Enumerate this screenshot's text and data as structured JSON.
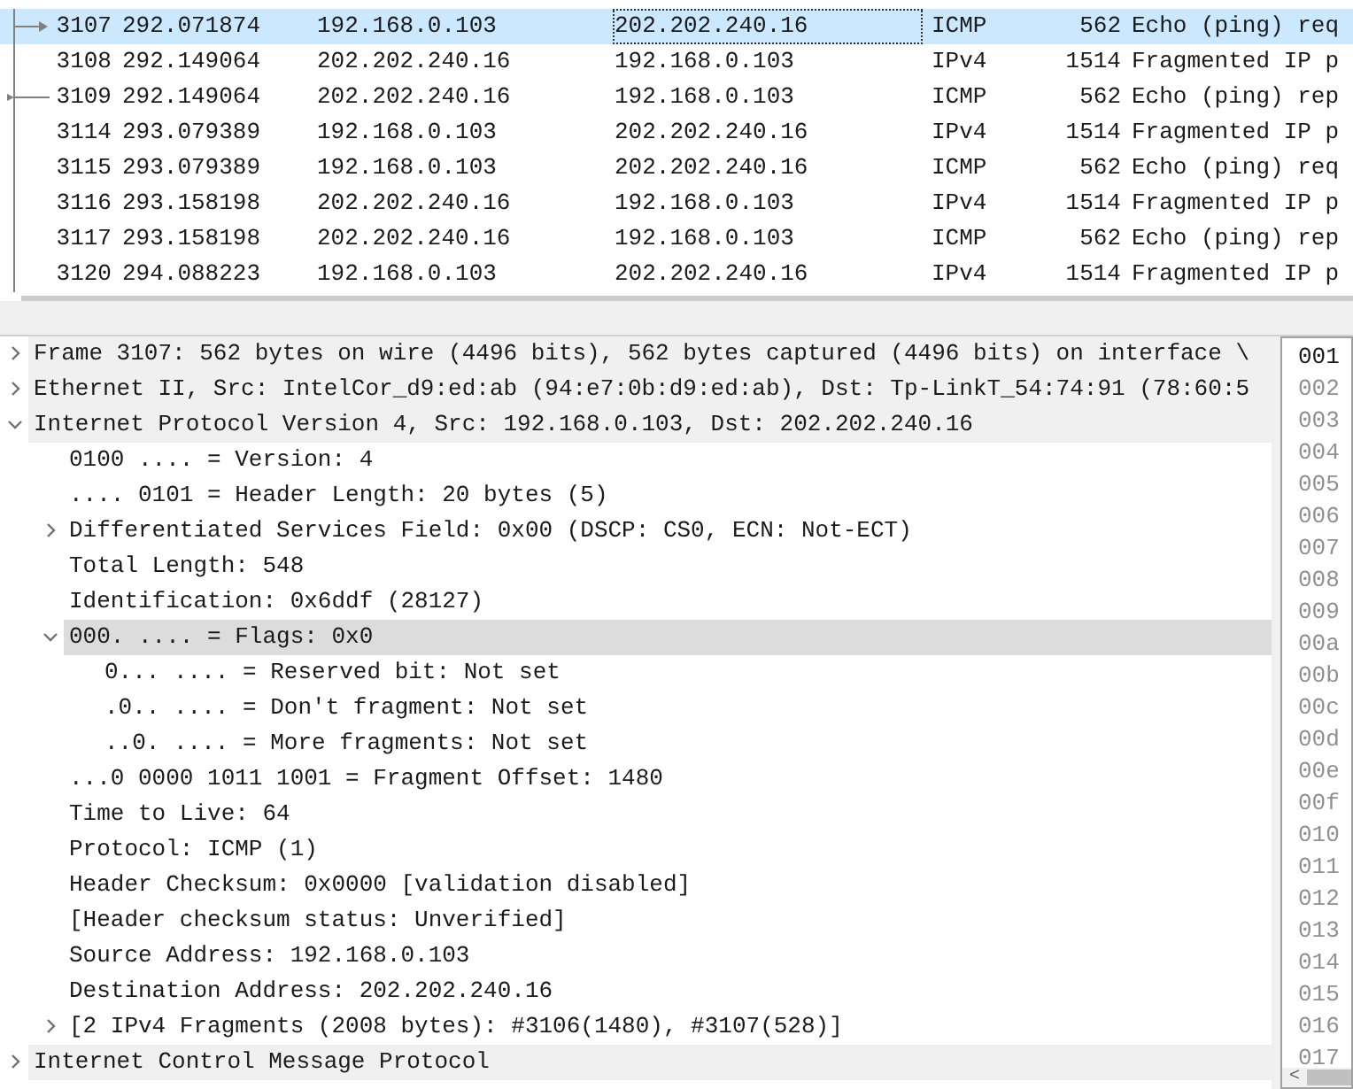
{
  "packets": [
    {
      "kind": "request",
      "no": "3107",
      "time": "292.071874",
      "source": "192.168.0.103",
      "destination": "202.202.240.16",
      "protocol": "ICMP",
      "length": "562",
      "info": "Echo (ping) req",
      "selected": true
    },
    {
      "kind": "line",
      "no": "3108",
      "time": "292.149064",
      "source": "202.202.240.16",
      "destination": "192.168.0.103",
      "protocol": "IPv4",
      "length": "1514",
      "info": "Fragmented IP p",
      "selected": false
    },
    {
      "kind": "reply",
      "no": "3109",
      "time": "292.149064",
      "source": "202.202.240.16",
      "destination": "192.168.0.103",
      "protocol": "ICMP",
      "length": "562",
      "info": "Echo (ping) rep",
      "selected": false
    },
    {
      "kind": "line",
      "no": "3114",
      "time": "293.079389",
      "source": "192.168.0.103",
      "destination": "202.202.240.16",
      "protocol": "IPv4",
      "length": "1514",
      "info": "Fragmented IP p",
      "selected": false
    },
    {
      "kind": "line",
      "no": "3115",
      "time": "293.079389",
      "source": "192.168.0.103",
      "destination": "202.202.240.16",
      "protocol": "ICMP",
      "length": "562",
      "info": "Echo (ping) req",
      "selected": false
    },
    {
      "kind": "line",
      "no": "3116",
      "time": "293.158198",
      "source": "202.202.240.16",
      "destination": "192.168.0.103",
      "protocol": "IPv4",
      "length": "1514",
      "info": "Fragmented IP p",
      "selected": false
    },
    {
      "kind": "line",
      "no": "3117",
      "time": "293.158198",
      "source": "202.202.240.16",
      "destination": "192.168.0.103",
      "protocol": "ICMP",
      "length": "562",
      "info": "Echo (ping) rep",
      "selected": false
    },
    {
      "kind": "line",
      "no": "3120",
      "time": "294.088223",
      "source": "192.168.0.103",
      "destination": "202.202.240.16",
      "protocol": "IPv4",
      "length": "1514",
      "info": "Fragmented IP p",
      "selected": false
    }
  ],
  "details": [
    {
      "text": "Frame 3107: 562 bytes on wire (4496 bits), 562 bytes captured (4496 bits) on interface \\",
      "expanded": false,
      "selected": false
    },
    {
      "text": "Ethernet II, Src: IntelCor_d9:ed:ab (94:e7:0b:d9:ed:ab), Dst: Tp-LinkT_54:74:91 (78:60:5",
      "expanded": false,
      "selected": false
    },
    {
      "text": "Internet Protocol Version 4, Src: 192.168.0.103, Dst: 202.202.240.16",
      "expanded": true,
      "selected": false,
      "children": [
        {
          "text": "0100 .... = Version: 4",
          "selected": false
        },
        {
          "text": ".... 0101 = Header Length: 20 bytes (5)",
          "selected": false
        },
        {
          "text": "Differentiated Services Field: 0x00 (DSCP: CS0, ECN: Not-ECT)",
          "expanded": false,
          "selected": false
        },
        {
          "text": "Total Length: 548",
          "selected": false
        },
        {
          "text": "Identification: 0x6ddf (28127)",
          "selected": false
        },
        {
          "text": "000. .... = Flags: 0x0",
          "expanded": true,
          "selected": true,
          "children": [
            {
              "text": "0... .... = Reserved bit: Not set",
              "selected": false
            },
            {
              "text": ".0.. .... = Don't fragment: Not set",
              "selected": false
            },
            {
              "text": "..0. .... = More fragments: Not set",
              "selected": false
            }
          ]
        },
        {
          "text": "...0 0000 1011 1001 = Fragment Offset: 1480",
          "selected": false
        },
        {
          "text": "Time to Live: 64",
          "selected": false
        },
        {
          "text": "Protocol: ICMP (1)",
          "selected": false
        },
        {
          "text": "Header Checksum: 0x0000 [validation disabled]",
          "selected": false
        },
        {
          "text": "[Header checksum status: Unverified]",
          "selected": false
        },
        {
          "text": "Source Address: 192.168.0.103",
          "selected": false
        },
        {
          "text": "Destination Address: 202.202.240.16",
          "selected": false
        },
        {
          "text": "[2 IPv4 Fragments (2008 bytes): #3106(1480), #3107(528)]",
          "expanded": false,
          "selected": false
        }
      ]
    },
    {
      "text": "Internet Control Message Protocol",
      "expanded": false,
      "selected": false
    }
  ],
  "hex_offsets": [
    {
      "text": "001",
      "selected": true
    },
    {
      "text": "002",
      "selected": false
    },
    {
      "text": "003",
      "selected": false
    },
    {
      "text": "004",
      "selected": false
    },
    {
      "text": "005",
      "selected": false
    },
    {
      "text": "006",
      "selected": false
    },
    {
      "text": "007",
      "selected": false
    },
    {
      "text": "008",
      "selected": false
    },
    {
      "text": "009",
      "selected": false
    },
    {
      "text": "00a",
      "selected": false
    },
    {
      "text": "00b",
      "selected": false
    },
    {
      "text": "00c",
      "selected": false
    },
    {
      "text": "00d",
      "selected": false
    },
    {
      "text": "00e",
      "selected": false
    },
    {
      "text": "00f",
      "selected": false
    },
    {
      "text": "010",
      "selected": false
    },
    {
      "text": "011",
      "selected": false
    },
    {
      "text": "012",
      "selected": false
    },
    {
      "text": "013",
      "selected": false
    },
    {
      "text": "014",
      "selected": false
    },
    {
      "text": "015",
      "selected": false
    },
    {
      "text": "016",
      "selected": false
    },
    {
      "text": "017",
      "selected": false
    }
  ],
  "hex_scroll_left": "<"
}
